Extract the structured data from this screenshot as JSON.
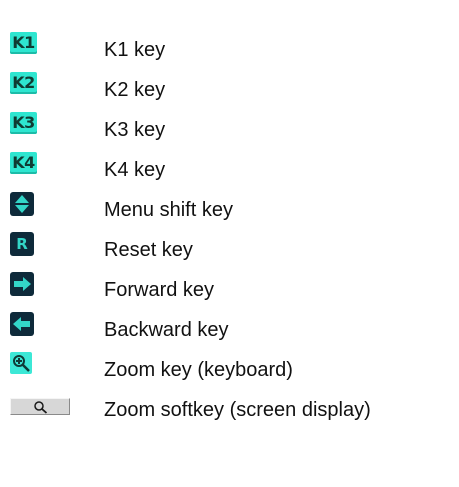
{
  "legend": {
    "rows": [
      {
        "icon": "k1-key-icon",
        "icon_text": "K1",
        "label": "K1 key"
      },
      {
        "icon": "k2-key-icon",
        "icon_text": "K2",
        "label": "K2 key"
      },
      {
        "icon": "k3-key-icon",
        "icon_text": "K3",
        "label": "K3 key"
      },
      {
        "icon": "k4-key-icon",
        "icon_text": "K4",
        "label": "K4 key"
      },
      {
        "icon": "menu-shift-icon",
        "label": "Menu shift key"
      },
      {
        "icon": "reset-key-icon",
        "icon_text": "R",
        "label": "Reset key"
      },
      {
        "icon": "forward-arrow-icon",
        "label": "Forward key"
      },
      {
        "icon": "backward-arrow-icon",
        "label": "Backward key"
      },
      {
        "icon": "zoom-magnifier-icon",
        "label": "Zoom key (keyboard)"
      },
      {
        "icon": "zoom-softkey-magnifier-icon",
        "label": "Zoom softkey (screen display)"
      }
    ]
  },
  "colors": {
    "key_cyan": "#2ee6d0",
    "key_navy": "#0e2a3a",
    "softkey_gray": "#d7d7d7",
    "text": "#111111"
  }
}
